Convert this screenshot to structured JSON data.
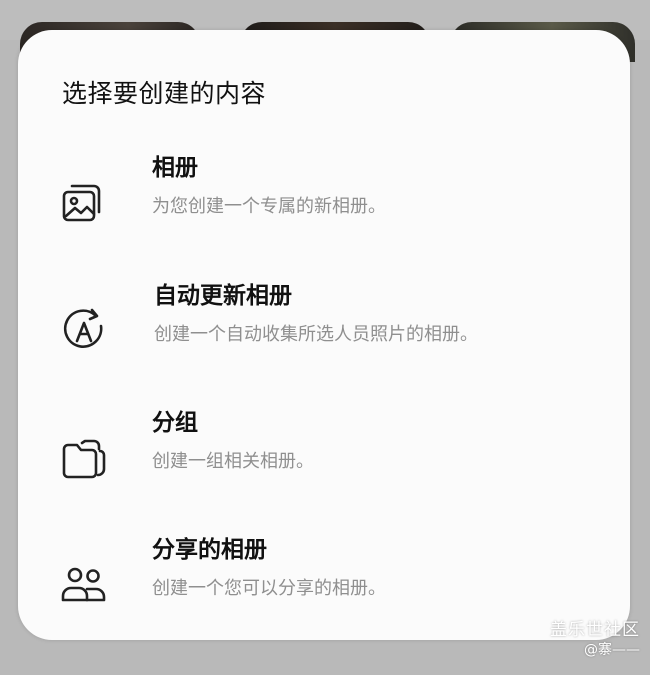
{
  "dialog": {
    "title": "选择要创建的内容",
    "options": [
      {
        "icon": "album-icon",
        "label": "相册",
        "description": "为您创建一个专属的新相册。"
      },
      {
        "icon": "auto-update-icon",
        "label": "自动更新相册",
        "description": "创建一个自动收集所选人员照片的相册。"
      },
      {
        "icon": "folder-group-icon",
        "label": "分组",
        "description": "创建一组相关相册。"
      },
      {
        "icon": "shared-people-icon",
        "label": "分享的相册",
        "description": "创建一个您可以分享的相册。"
      }
    ]
  },
  "watermark": {
    "name": "盖乐世社区",
    "user": "@寨——"
  }
}
